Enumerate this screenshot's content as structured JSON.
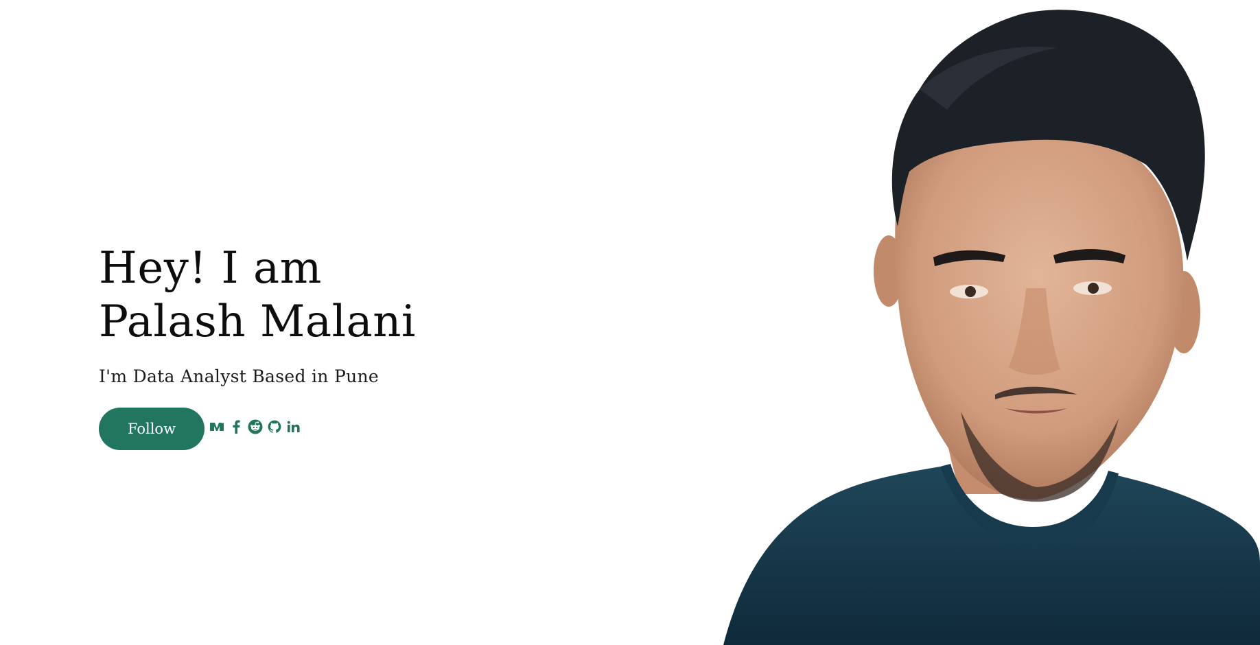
{
  "hero": {
    "title_line1": "Hey! I am",
    "title_line2": "Palash Malani",
    "subtitle": "I'm Data Analyst Based in Pune",
    "follow_label": "Follow"
  },
  "social": [
    {
      "icon": "medium-icon"
    },
    {
      "icon": "facebook-icon"
    },
    {
      "icon": "reddit-icon"
    },
    {
      "icon": "github-icon"
    },
    {
      "icon": "linkedin-icon"
    }
  ],
  "colors": {
    "accent": "#22765f",
    "text": "#111111",
    "background": "#ffffff",
    "shirt": "#163447",
    "hair": "#1c2128",
    "skin": "#d9a88a"
  }
}
